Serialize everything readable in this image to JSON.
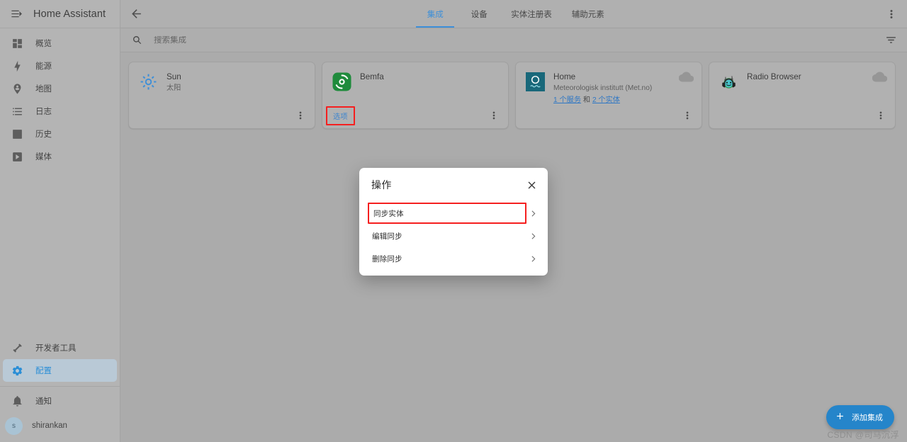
{
  "sidebar": {
    "menu_icon": "menu-open-icon",
    "title": "Home Assistant",
    "items": [
      {
        "icon": "view-dashboard-icon",
        "label": "概览"
      },
      {
        "icon": "lightning-bolt-icon",
        "label": "能源"
      },
      {
        "icon": "map-marker-account-icon",
        "label": "地图"
      },
      {
        "icon": "format-list-bulleted-icon",
        "label": "日志"
      },
      {
        "icon": "chart-bar-icon",
        "label": "历史"
      },
      {
        "icon": "play-box-multiple-icon",
        "label": "媒体"
      }
    ],
    "bottom_items": [
      {
        "icon": "hammer-wrench-icon",
        "label": "开发者工具",
        "active": false
      },
      {
        "icon": "cog-icon",
        "label": "配置",
        "active": true
      }
    ],
    "notifications": {
      "icon": "bell-icon",
      "label": "通知"
    },
    "user": {
      "initial": "s",
      "label": "shirankan"
    }
  },
  "topbar": {
    "back_icon": "arrow-left-icon",
    "more_icon": "dots-vertical-icon",
    "tabs": [
      {
        "label": "集成",
        "active": true
      },
      {
        "label": "设备",
        "active": false
      },
      {
        "label": "实体注册表",
        "active": false
      },
      {
        "label": "辅助元素",
        "active": false
      }
    ]
  },
  "search": {
    "icon": "search-icon",
    "placeholder": "搜索集成",
    "value": "",
    "filter_icon": "filter-variant-icon"
  },
  "cards": [
    {
      "id": "sun",
      "icon": "sun-integration-icon",
      "title": "Sun",
      "subtitle": "太阳",
      "cloud": false,
      "options_button": null,
      "links": null,
      "kebab_icon": "dots-vertical-icon"
    },
    {
      "id": "bemfa",
      "icon": "bemfa-integration-icon",
      "title": "Bemfa",
      "subtitle": "",
      "cloud": false,
      "options_button": "选项",
      "links": null,
      "kebab_icon": "dots-vertical-icon"
    },
    {
      "id": "home-metno",
      "icon": "metno-integration-icon",
      "title": "Home",
      "subtitle": "Meteorologisk institutt (Met.no)",
      "cloud": true,
      "options_button": null,
      "links": {
        "services": "1 个服务",
        "conjunction": "和",
        "entities": "2 个实体"
      },
      "kebab_icon": "dots-vertical-icon"
    },
    {
      "id": "radio-browser",
      "icon": "radio-browser-integration-icon",
      "title": "Radio Browser",
      "subtitle": "",
      "cloud": true,
      "options_button": null,
      "links": null,
      "kebab_icon": "dots-vertical-icon"
    }
  ],
  "fab": {
    "icon": "plus-icon",
    "label": "添加集成"
  },
  "watermark": "CSDN @司马沉浮",
  "dialog": {
    "title": "操作",
    "close_icon": "close-icon",
    "rows": [
      {
        "label": "同步实体",
        "highlighted": true,
        "chevron": "chevron-right-icon"
      },
      {
        "label": "编辑同步",
        "highlighted": false,
        "chevron": "chevron-right-icon"
      },
      {
        "label": "删除同步",
        "highlighted": false,
        "chevron": "chevron-right-icon"
      }
    ]
  },
  "colors": {
    "accent": "#2585ca",
    "tab_active": "#3d8fd8",
    "annotation": "#f51f1f",
    "sidebar_active_bg": "#b9c9d6",
    "bemfa_green": "#1f8b3c",
    "metno_teal": "#19687a"
  }
}
